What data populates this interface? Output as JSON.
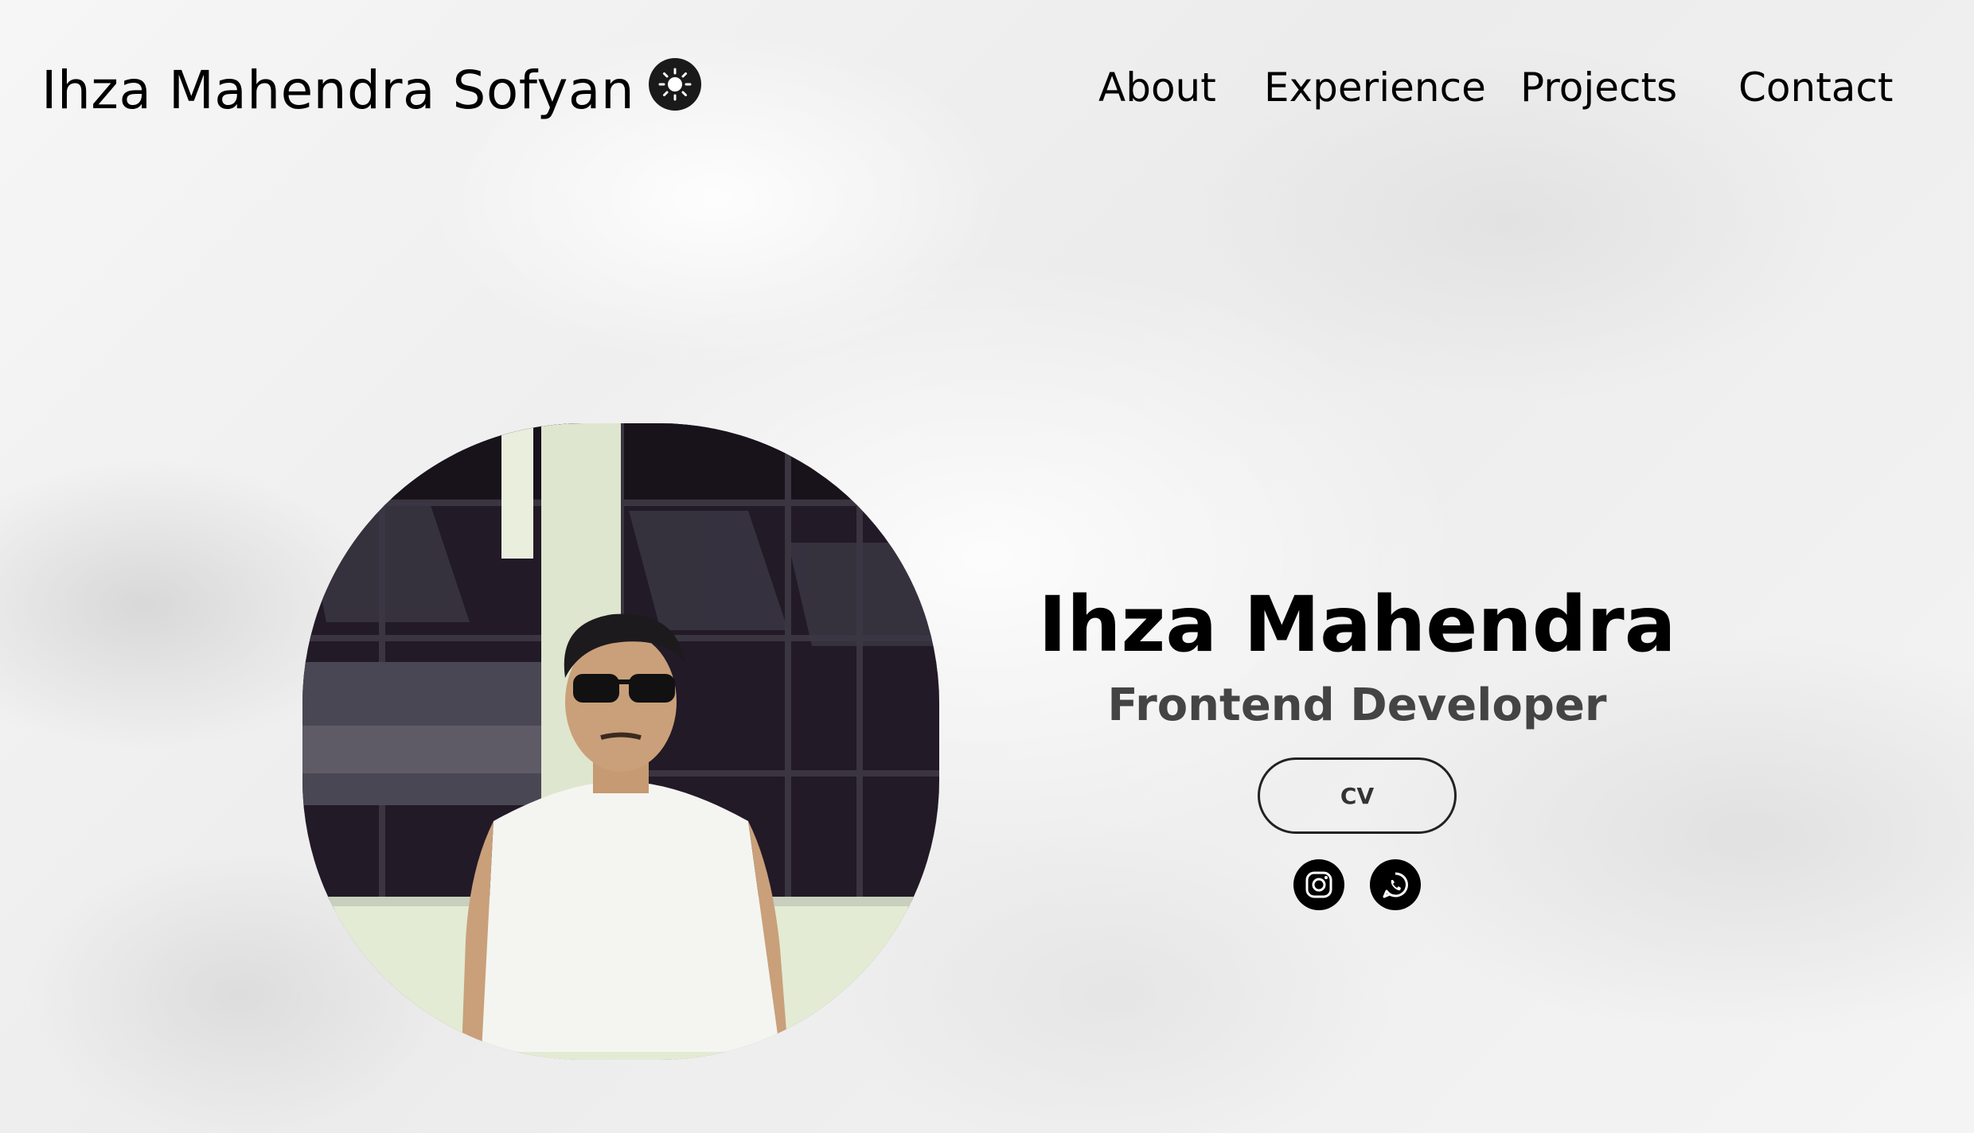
{
  "header": {
    "logo_text": "Ihza Mahendra Sofyan",
    "theme_icon": "sun-icon"
  },
  "nav": {
    "items": [
      {
        "label": "About"
      },
      {
        "label": "Experience"
      },
      {
        "label": "Projects"
      },
      {
        "label": "Contact"
      }
    ]
  },
  "hero": {
    "photo_icon": "profile-photo",
    "name": "Ihza Mahendra",
    "role": "Frontend Developer",
    "cv_label": "CV",
    "socials": [
      {
        "icon": "instagram-icon"
      },
      {
        "icon": "whatsapp-icon"
      }
    ]
  },
  "colors": {
    "text": "#000000",
    "role_text": "#444444",
    "icon_bg": "#000000",
    "background": "#f3f3f3"
  }
}
